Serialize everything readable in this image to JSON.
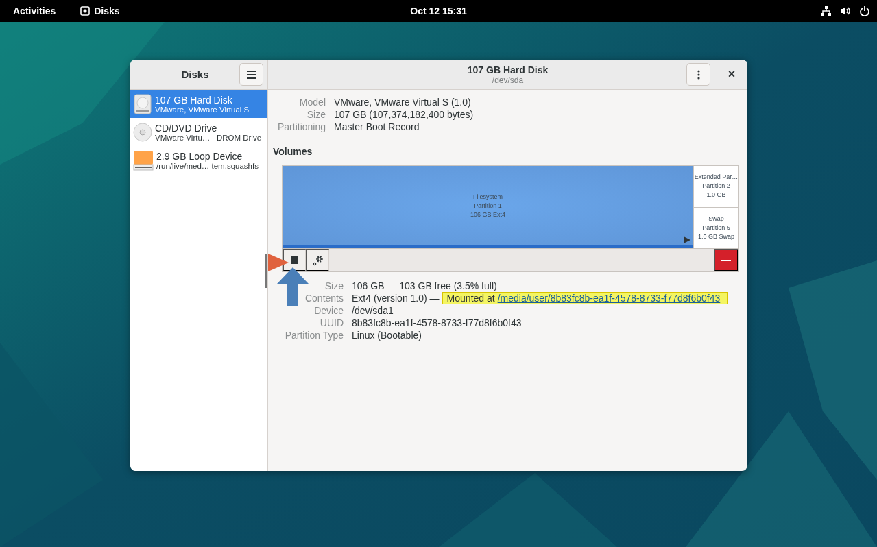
{
  "top_bar": {
    "activities": "Activities",
    "app_name": "Disks",
    "clock": "Oct 12  15:31"
  },
  "sidebar": {
    "title": "Disks",
    "items": [
      {
        "kind": "hdd",
        "name": "107 GB Hard Disk",
        "subtitle": "VMware, VMware Virtual S",
        "selected": true
      },
      {
        "kind": "optical",
        "name": "CD/DVD Drive",
        "subtitle": "VMware Virtu…   DROM Drive",
        "selected": false
      },
      {
        "kind": "loop",
        "name": "2.9 GB Loop Device",
        "subtitle": "/run/live/med… tem.squashfs",
        "selected": false
      }
    ]
  },
  "header": {
    "title": "107 GB Hard Disk",
    "subtitle": "/dev/sda",
    "close": "×"
  },
  "drive_info": [
    {
      "label": "Model",
      "value": "VMware, VMware Virtual S (1.0)"
    },
    {
      "label": "Size",
      "value": "107 GB (107,374,182,400 bytes)"
    },
    {
      "label": "Partitioning",
      "value": "Master Boot Record"
    }
  ],
  "volumes": {
    "heading": "Volumes",
    "main": {
      "lines": [
        "Filesystem",
        "Partition 1",
        "106 GB Ext4"
      ],
      "selected": true
    },
    "extended": [
      {
        "lines": [
          "Extended Par…",
          "Partition 2",
          "1.0 GB"
        ],
        "selected": false
      },
      {
        "lines": [
          "Swap",
          "Partition 5",
          "1.0 GB Swap"
        ],
        "selected": false
      }
    ]
  },
  "details": [
    {
      "label": "Size",
      "value": "106 GB — 103 GB free (3.5% full)"
    },
    {
      "label": "Contents",
      "value": "Ext4 (version 1.0) —",
      "mount": {
        "prefix": "Mounted at",
        "link": "/media/user/8b83fc8b-ea1f-4578-8733-f77d8f6b0f43",
        "highlighted": true
      }
    },
    {
      "label": "Device",
      "value": "/dev/sda1"
    },
    {
      "label": "UUID",
      "value": "8b83fc8b-ea1f-4578-8733-f77d8f6b0f43"
    },
    {
      "label": "Partition Type",
      "value": "Linux (Bootable)"
    }
  ]
}
